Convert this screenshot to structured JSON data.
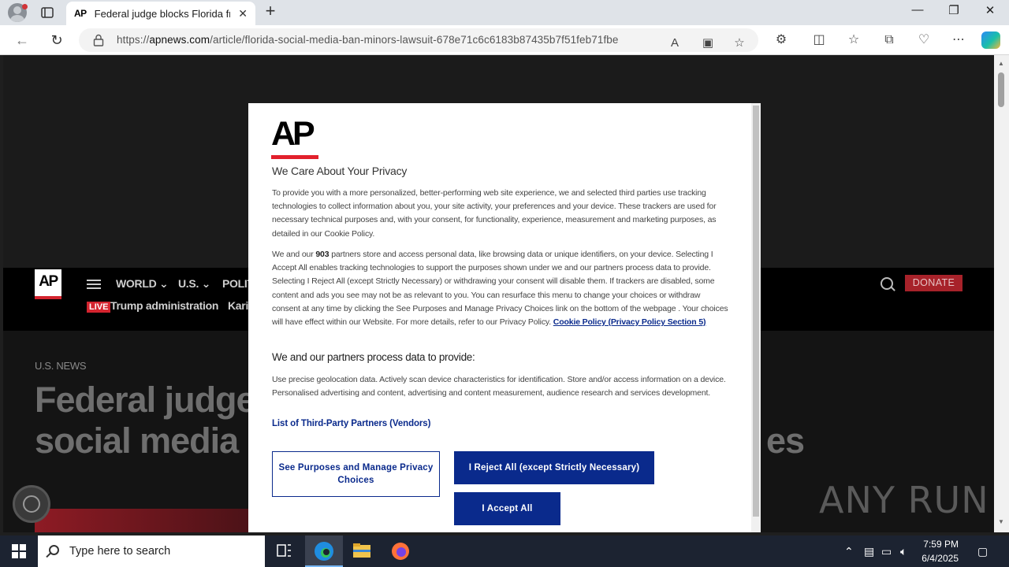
{
  "browser": {
    "tab_title": "Federal judge blocks Florida from",
    "tab_favicon": "AP",
    "url_prefix": "https://",
    "url_domain": "apnews.com",
    "url_path": "/article/florida-social-media-ban-minors-lawsuit-678e71c6c6183b87435b7f51feb71fbe"
  },
  "site": {
    "logo": "AP",
    "nav_items": [
      "WORLD",
      "U.S.",
      "POLIT"
    ],
    "live_badge": "LIVE",
    "sub_links": [
      "Trump administration",
      "Kari"
    ],
    "donate_label": "DONATE",
    "section_label": "U.S. NEWS",
    "headline_line1": "Federal judge",
    "headline_line2": "social media b",
    "headline_tail": "es",
    "watermark": "ANY RUN"
  },
  "consent": {
    "logo": "AP",
    "title": "We Care About Your Privacy",
    "para1": "To provide you with a more personalized, better-performing web site experience, we and selected third parties use tracking technologies to collect information about you, your site activity, your preferences and your device. These trackers are used for necessary technical purposes and, with your consent, for functionality, experience, measurement and marketing purposes, as detailed in our Cookie Policy.",
    "para2_a": "We and our ",
    "para2_count": "903",
    "para2_b": " partners store and access personal data, like browsing data or unique identifiers, on your device. Selecting I Accept All enables tracking technologies to support the purposes shown under we and our partners process data to provide. Selecting I Reject All (except Strictly Necessary) or withdrawing your consent will disable them. If trackers are disabled, some content and ads you see may not be as relevant to you. You can resurface this menu to change your choices or withdraw consent at any time by clicking the See Purposes and Manage Privacy Choices link on the bottom of the webpage . Your choices will have effect within our Website. For more details, refer to our Privacy Policy. ",
    "cookie_link": "Cookie Policy (Privacy Policy Section 5)",
    "subheading": "We and our partners process data to provide:",
    "para3": "Use precise geolocation data. Actively scan device characteristics for identification. Store and/or access information on a device. Personalised advertising and content, advertising and content measurement, audience research and services development.",
    "vendor_link": "List of Third-Party Partners (Vendors)",
    "btn_manage": "See Purposes and Manage Privacy Choices",
    "btn_reject": "I Reject All (except Strictly Necessary)",
    "btn_accept": "I Accept All"
  },
  "taskbar": {
    "search_placeholder": "Type here to search",
    "time": "7:59 PM",
    "date": "6/4/2025"
  }
}
